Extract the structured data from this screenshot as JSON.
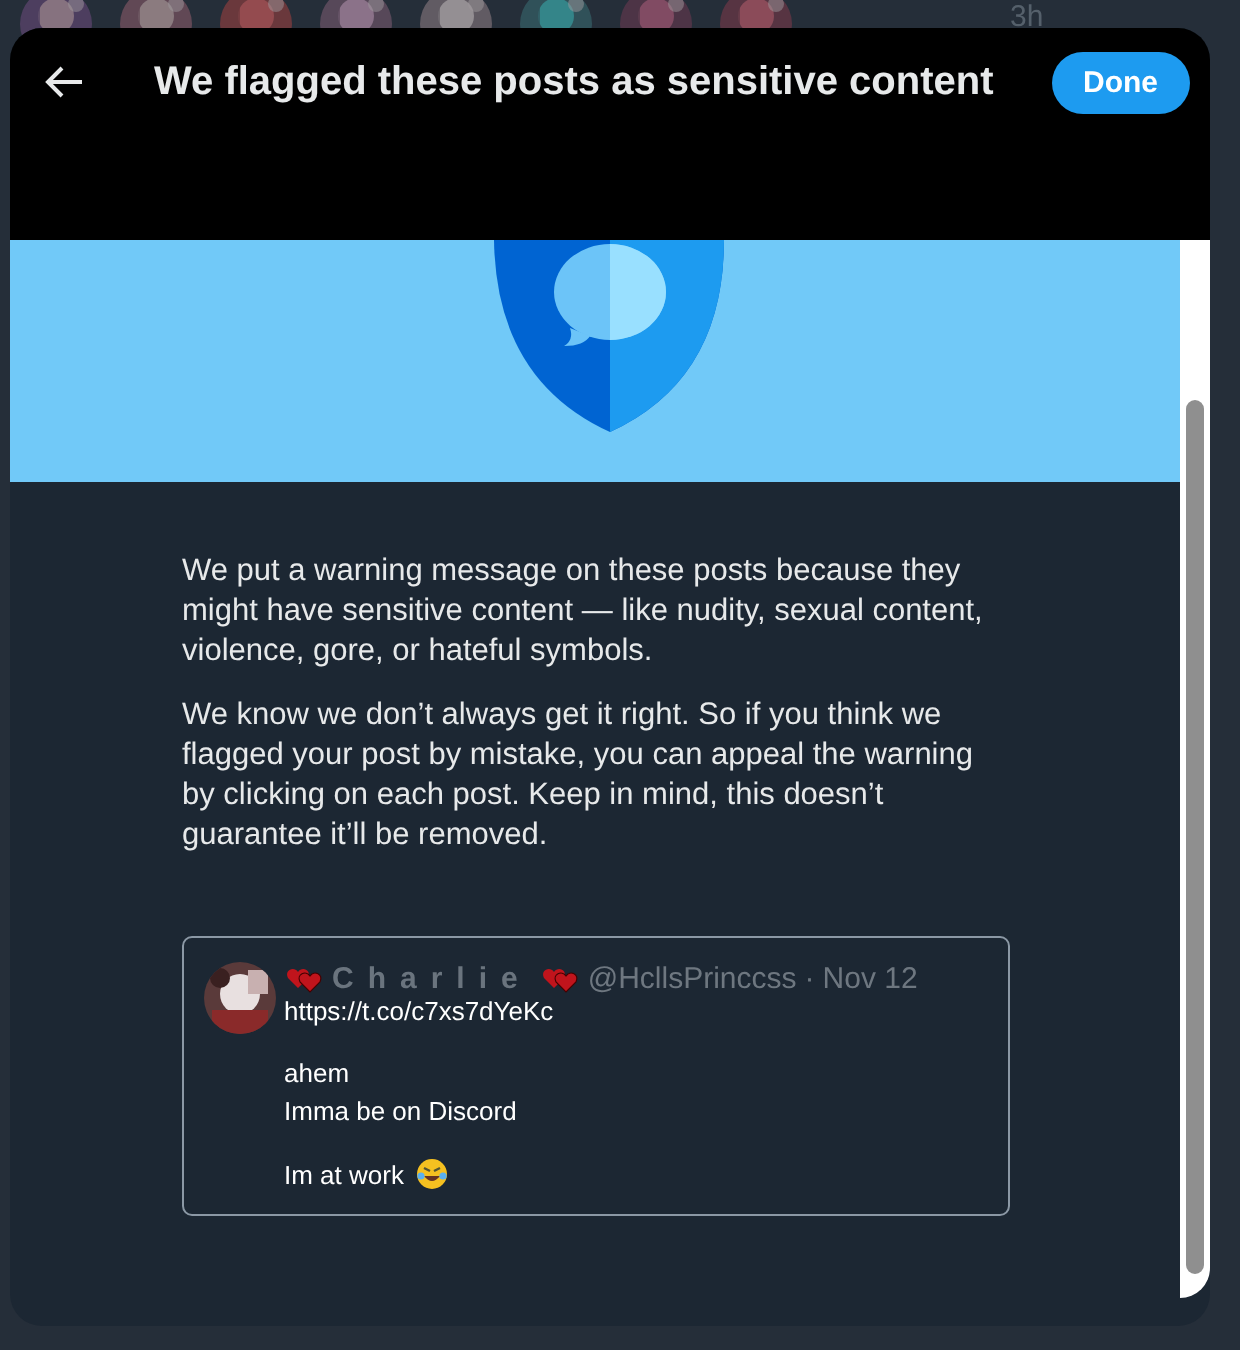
{
  "backdrop": {
    "timestamp": "3h"
  },
  "modal": {
    "title": "We flagged these posts as sensitive content",
    "done_button": "Done",
    "paragraphs": [
      "We put a warning message on these posts because they might have sensitive content — like nudity, sexual content, violence, gore, or hateful symbols.",
      "We know we don’t always get it right. So if you think we flagged your post by mistake, you can appeal the warning by clicking on each post. Keep in mind, this doesn’t guarantee it’ll be removed."
    ],
    "post": {
      "author": "Charlie",
      "handle": "@HcllsPrinccss",
      "separator": "·",
      "date": "Nov 12",
      "blocks": [
        {
          "kind": "text",
          "lines": [
            "https://t.co/c7xs7dYeKc"
          ]
        },
        {
          "kind": "text",
          "lines": [
            "ahem",
            "Imma be on Discord"
          ]
        },
        {
          "kind": "emoji_end",
          "lines": [
            "Im at work"
          ]
        }
      ]
    }
  }
}
